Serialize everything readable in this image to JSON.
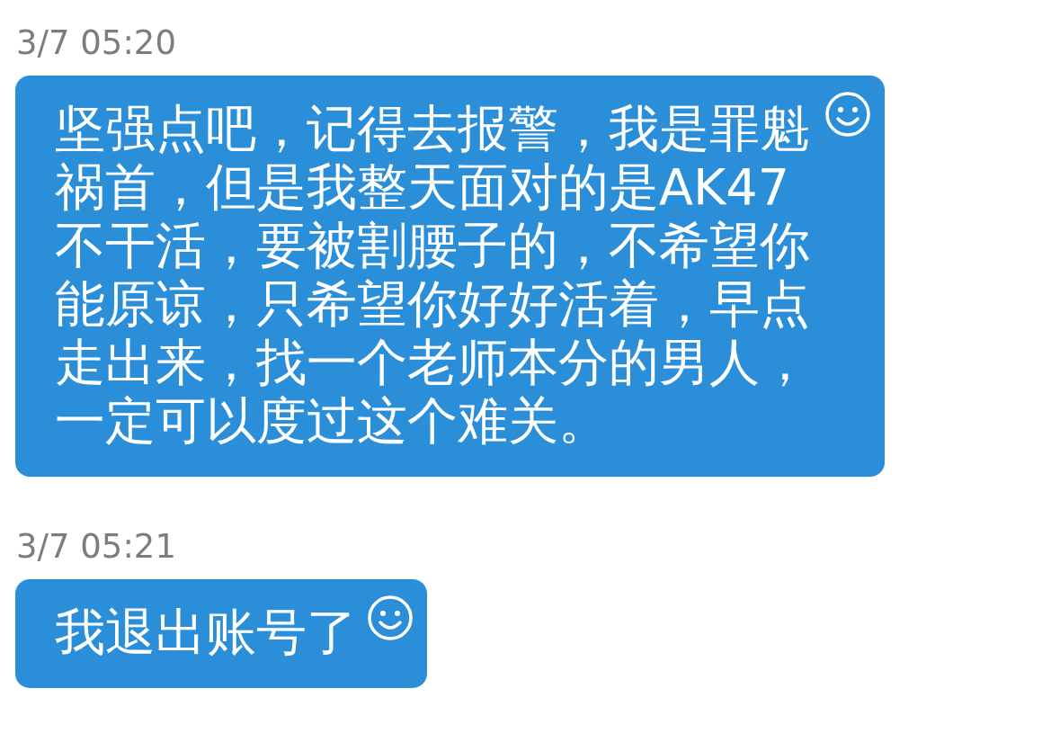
{
  "messages": [
    {
      "time": "3/7 05:20",
      "text": "坚强点吧，记得去报警，我是罪魁祸首，但是我整天面对的是AK47不干活，要被割腰子的，不希望你能原谅，只希望你好好活着，早点走出来，找一个老师本分的男人，一定可以度过这个难关。"
    },
    {
      "time": "3/7 05:21",
      "text": "我退出账号了"
    }
  ]
}
